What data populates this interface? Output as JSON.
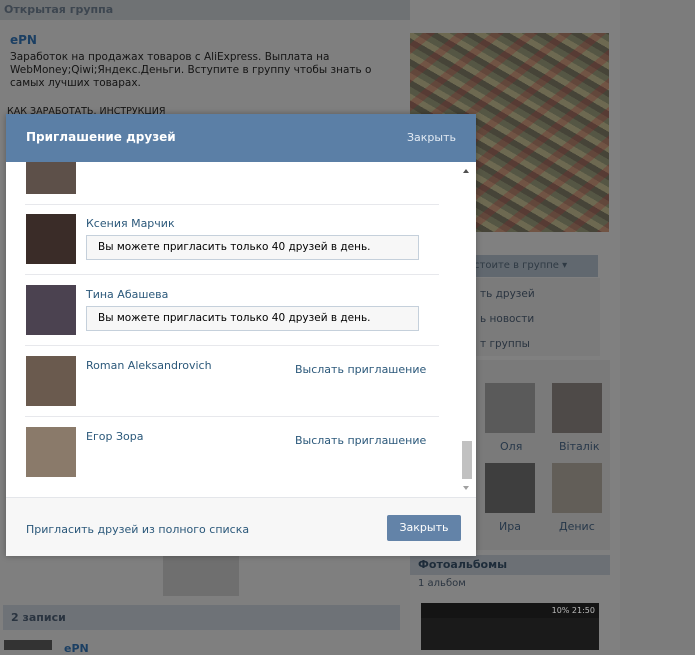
{
  "background": {
    "group_header": "Открытая группа",
    "group_name": "ePN",
    "group_description": "Заработок на продажах товаров с AliExpress. Выплата на WebMoney;Qiwi;Яндекс.Деньги. Вступите в группу чтобы знать о самых лучших товарах.",
    "how_to_link": "КАК ЗАРАБОТАТЬ. ИНСТРУКЦИЯ",
    "member_button": "стоите в группе ▾",
    "menu_items": [
      "ть друзей",
      "ь новости",
      "т группы"
    ],
    "friends": [
      "Оля",
      "Віталік",
      "Ира",
      "Денис"
    ],
    "albums_header": "Фотоальбомы",
    "albums_count": "1 альбом",
    "album_status": "10%  21:50",
    "posts_header": "2 записи",
    "post_author": "ePN"
  },
  "modal": {
    "title": "Приглашение друзей",
    "close_link": "Закрыть",
    "rows": [
      {
        "name": "",
        "avatar_color": "#5d5049"
      },
      {
        "name": "Ксения Марчик",
        "limit_text": "Вы можете пригласить только 40 друзей в день.",
        "avatar_color": "#3a2c28"
      },
      {
        "name": "Тина Абашева",
        "limit_text": "Вы можете пригласить только 40 друзей в день.",
        "avatar_color": "#4b4250"
      },
      {
        "name": "Roman Aleksandrovich",
        "invite_text": "Выслать приглашение",
        "avatar_color": "#6a5a4e"
      },
      {
        "name": "Егор Зора",
        "invite_text": "Выслать приглашение",
        "avatar_color": "#8a7a6a"
      }
    ],
    "footer_link": "Пригласить друзей из полного списка",
    "footer_button": "Закрыть"
  }
}
